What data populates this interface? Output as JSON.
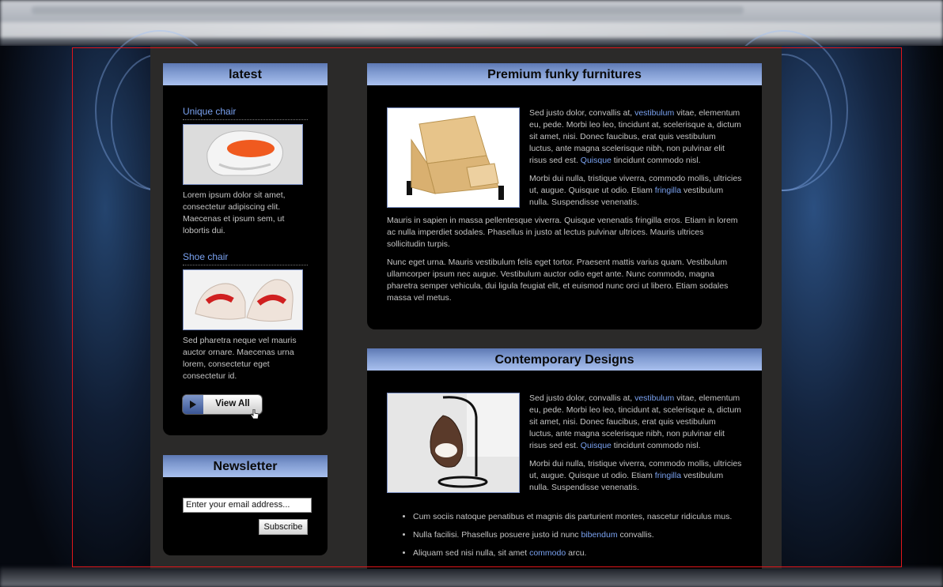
{
  "colors": {
    "accent_link": "#7aa2f0",
    "header_gradient_start": "#5d78b3",
    "header_gradient_end": "#a9c0ee",
    "frame": "#e0161b",
    "panel_bg": "#000000",
    "page_bg": "#2b2a29"
  },
  "sidebar": {
    "latest": {
      "title": "latest",
      "items": [
        {
          "title": "Unique chair",
          "image": "white-orange-chair-image",
          "text": "Lorem ipsum dolor sit amet, consectetur adipiscing elit. Maecenas et ipsum sem, ut lobortis dui."
        },
        {
          "title": "Shoe chair",
          "image": "shoe-chair-image",
          "text": "Sed pharetra neque vel mauris auctor ornare. Maecenas urna lorem, consectetur eget consectetur id."
        }
      ],
      "view_all_label": "View All",
      "view_all_icon": "play-icon",
      "cursor_icon": "hand-cursor-icon"
    },
    "newsletter": {
      "title": "Newsletter",
      "email_value": "Enter your email address...",
      "subscribe_label": "Subscribe"
    }
  },
  "main": {
    "articles": [
      {
        "title": "Premium funky furnitures",
        "image": "wooden-furniture-image",
        "p1": {
          "t1": "Sed justo dolor, convallis at, ",
          "l1": "vestibulum",
          "t2": " vitae, elementum eu, pede. Morbi leo leo, tincidunt at, scelerisque a, dictum sit amet, nisi. Donec faucibus, erat quis vestibulum luctus, ante magna scelerisque nibh, non pulvinar elit risus sed est. ",
          "l2": "Quisque",
          "t3": " tincidunt commodo nisl."
        },
        "p2": {
          "t1": "Morbi dui nulla, tristique viverra, commodo mollis, ultricies ut, augue. Quisque ut odio. Etiam ",
          "l1": "fringilla",
          "t2": " vestibulum nulla. Suspendisse venenatis."
        },
        "p3": "Mauris in sapien in massa pellentesque viverra. Quisque venenatis fringilla eros. Etiam in lorem ac nulla imperdiet sodales. Phasellus in justo at lectus pulvinar ultrices. Mauris ultrices sollicitudin turpis.",
        "p4": "Nunc eget urna. Mauris vestibulum felis eget tortor. Praesent mattis varius quam. Vestibulum ullamcorper ipsum nec augue. Vestibulum auctor odio eget ante. Nunc commodo, magna pharetra semper vehicula, dui ligula feugiat elit, et euismod nunc orci ut libero. Etiam sodales massa vel metus."
      },
      {
        "title": "Contemporary Designs",
        "image": "hanging-egg-chair-image",
        "p1": {
          "t1": "Sed justo dolor, convallis at, ",
          "l1": "vestibulum",
          "t2": " vitae, elementum eu, pede. Morbi leo leo, tincidunt at, scelerisque a, dictum sit amet, nisi. Donec faucibus, erat quis vestibulum luctus, ante magna scelerisque nibh, non pulvinar elit risus sed est. ",
          "l2": "Quisque",
          "t3": " tincidunt commodo nisl."
        },
        "p2": {
          "t1": "Morbi dui nulla, tristique viverra, commodo mollis, ultricies ut, augue. Quisque ut odio. Etiam ",
          "l1": "fringilla",
          "t2": " vestibulum nulla. Suspendisse venenatis."
        },
        "bullets": [
          {
            "text": "Cum sociis natoque penatibus et magnis dis parturient montes, nascetur ridiculus mus."
          },
          {
            "text": "Nulla facilisi. Phasellus posuere justo id nunc ",
            "link": "bibendum",
            "after": " convallis."
          },
          {
            "text": "Aliquam sed nisi nulla, sit amet ",
            "link": "commodo",
            "after": " arcu."
          }
        ]
      }
    ]
  }
}
